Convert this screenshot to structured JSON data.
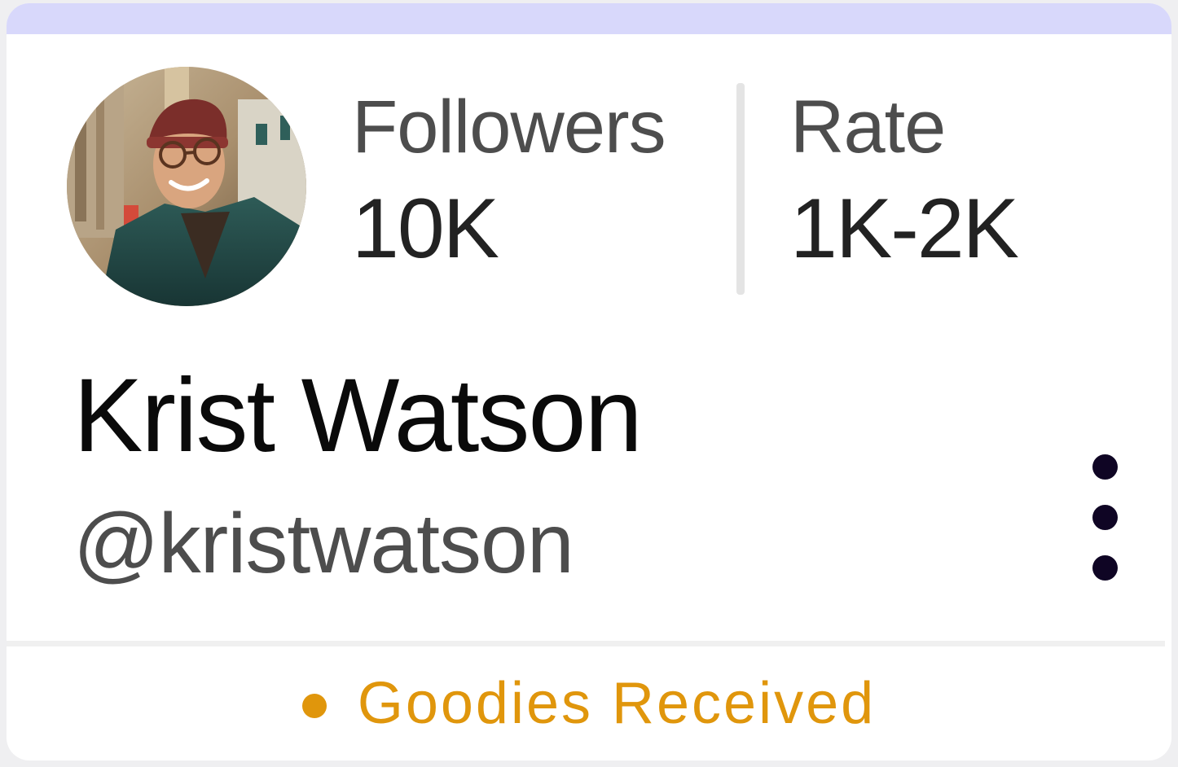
{
  "profile": {
    "name": "Krist Watson",
    "handle": "@kristwatson",
    "avatar_icon": "profile-photo"
  },
  "stats": {
    "followers": {
      "label": "Followers",
      "value": "10K"
    },
    "rate": {
      "label": "Rate",
      "value": "1K-2K"
    }
  },
  "actions": {
    "more_icon": "vertical-ellipsis-icon"
  },
  "status": {
    "text": "Goodies Received",
    "color": "#e0960c"
  },
  "colors": {
    "top_stripe": "#d8d8fb",
    "card_background": "#ffffff",
    "menu_dots": "#0f0524"
  }
}
